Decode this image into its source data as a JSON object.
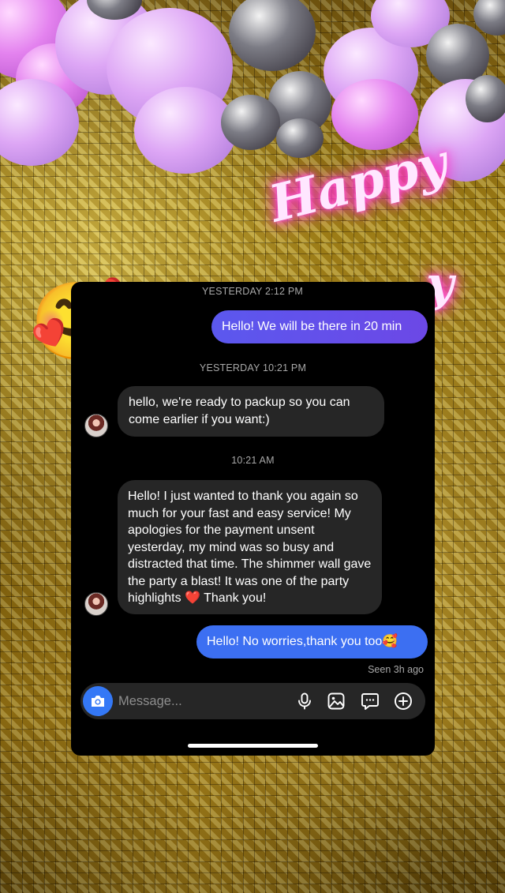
{
  "messages": [
    {
      "type": "timestamp",
      "text": "YESTERDAY 2:12 PM"
    },
    {
      "type": "outgoing",
      "text": "Hello! We will be there in 20 min"
    },
    {
      "type": "timestamp",
      "text": "YESTERDAY 10:21 PM"
    },
    {
      "type": "incoming",
      "text": "hello, we're ready to packup so you can come earlier if you want:)"
    },
    {
      "type": "timestamp",
      "text": "10:21 AM"
    },
    {
      "type": "incoming",
      "text": "Hello! I just wanted to thank you again so much for your fast and easy service! My apologies for the payment unsent yesterday, my mind was so busy and distracted that time. The shimmer wall gave the party a blast! It was one of the party highlights ❤️ Thank you!"
    },
    {
      "type": "outgoing",
      "text": "Hello! No worries,thank you too🥰"
    }
  ],
  "status": {
    "seen": "Seen 3h ago"
  },
  "composer": {
    "placeholder": "Message..."
  },
  "icons": [
    "camera-icon",
    "microphone-icon",
    "gallery-icon",
    "sticker-icon",
    "add-icon"
  ],
  "decor": {
    "emoji_hearts_face": "🥰",
    "emoji_wink": "😉",
    "neon_text": "Happy"
  },
  "colors": {
    "outgoing_bubble": "#5b58ee",
    "outgoing_bubble_2": "#3c6ff2",
    "incoming_bubble": "#262626",
    "camera_button": "#3478f6",
    "card_background": "#000000"
  }
}
